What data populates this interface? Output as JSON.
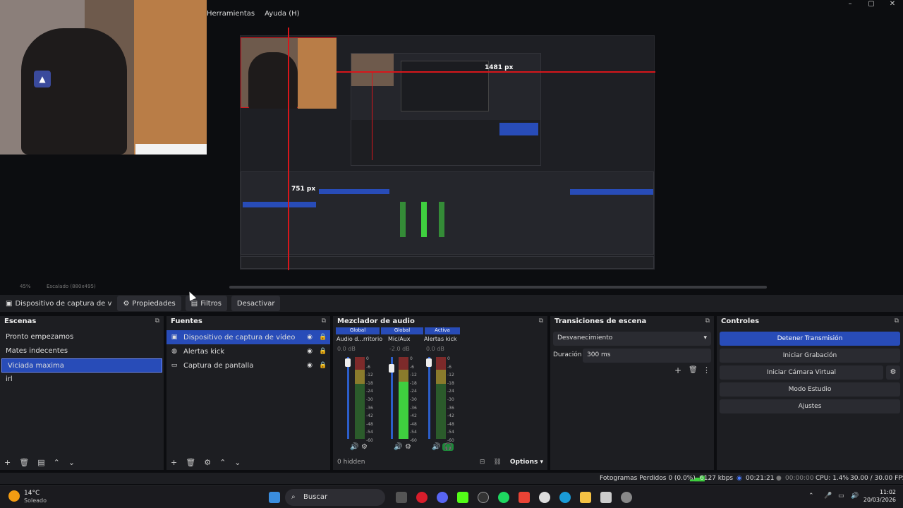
{
  "menubar": {
    "items": [
      "Herramientas",
      "Ayuda (H)"
    ]
  },
  "window_controls": {
    "minimize": "–",
    "maximize": "▢",
    "close": "✕"
  },
  "canvas": {
    "width_label": "1481 px",
    "height_label": "751 px"
  },
  "zoom_row": {
    "zoom": "45%",
    "scale_label": "Escalado (880x495)"
  },
  "source_toolbar": {
    "selected_source": "Dispositivo de captura de v",
    "properties": "Propiedades",
    "filters": "Filtros",
    "deactivate": "Desactivar"
  },
  "scenes": {
    "title": "Escenas",
    "items": [
      "Pronto empezamos",
      "Mates indecentes",
      "Viciada maxima",
      "irl"
    ],
    "selected": "Viciada maxima"
  },
  "sources": {
    "title": "Fuentes",
    "items": [
      "Dispositivo de captura de vídeo",
      "Alertas kick",
      "Captura de pantalla"
    ]
  },
  "mixer": {
    "title": "Mezclador de audio",
    "channels": [
      {
        "head": "Global",
        "name": "Audio d...rritorio",
        "db": "0.0 dB",
        "level": 0.0
      },
      {
        "head": "Global",
        "name": "Mic/Aux",
        "db": "-2.0 dB",
        "level": 0.7
      },
      {
        "head": "Activa",
        "name": "Alertas kick",
        "db": "0.0 dB",
        "level": 0.0
      }
    ],
    "scale": [
      "0",
      "-6",
      "-12",
      "-18",
      "-24",
      "-30",
      "-36",
      "-42",
      "-48",
      "-54",
      "-60"
    ],
    "hidden": "0 hidden",
    "options": "Options"
  },
  "transitions": {
    "title": "Transiciones de escena",
    "type": "Desvanecimiento",
    "duration_label": "Duración",
    "duration_value": "300 ms"
  },
  "controls": {
    "title": "Controles",
    "buttons": [
      "Detener Transmisión",
      "Iniciar Grabación",
      "Iniciar Cámara Virtual",
      "Modo Estudio",
      "Ajustes"
    ]
  },
  "status": {
    "dropped": "Fotogramas Perdidos 0 (0.0%)",
    "bitrate": "6127 kbps",
    "stream_time": "00:21:21",
    "rec_time": "00:00:00",
    "cpu": "CPU: 1.4%",
    "fps": "30.00 / 30.00 FPS"
  },
  "taskbar": {
    "weather_temp": "14°C",
    "weather_desc": "Soleado",
    "search": "Buscar",
    "time": "11:02",
    "date": "20/03/2026"
  },
  "colors": {
    "accent": "#284cb8",
    "red_guide": "#d7161b",
    "meter_green": "#3fcf3f"
  }
}
